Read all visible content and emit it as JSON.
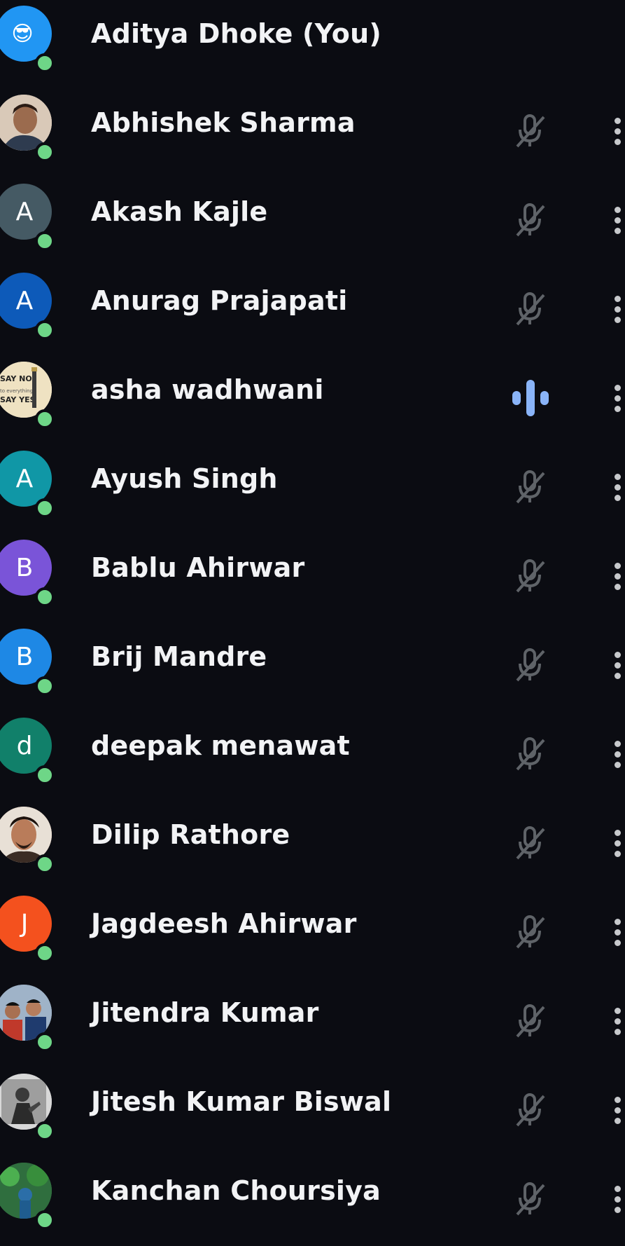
{
  "participants": [
    {
      "name": "Aditya Dhoke (You)",
      "avatar": {
        "type": "emoji",
        "glyph": "😎",
        "bg": "#2196f3"
      },
      "online": true,
      "mic": "none"
    },
    {
      "name": "Abhishek Sharma",
      "avatar": {
        "type": "photo",
        "bg": "#d9c9b8"
      },
      "online": true,
      "mic": "muted"
    },
    {
      "name": "Akash Kajle",
      "avatar": {
        "type": "initial",
        "letter": "A",
        "bg": "#455a64"
      },
      "online": true,
      "mic": "muted"
    },
    {
      "name": "Anurag Prajapati",
      "avatar": {
        "type": "initial",
        "letter": "A",
        "bg": "#0d5ab9"
      },
      "online": true,
      "mic": "muted"
    },
    {
      "name": "asha wadhwani",
      "avatar": {
        "type": "photo",
        "bg": "#efe2c2"
      },
      "online": true,
      "mic": "speaking"
    },
    {
      "name": "Ayush Singh",
      "avatar": {
        "type": "initial",
        "letter": "A",
        "bg": "#1097a6"
      },
      "online": true,
      "mic": "muted"
    },
    {
      "name": "Bablu Ahirwar",
      "avatar": {
        "type": "initial",
        "letter": "B",
        "bg": "#7a54d8"
      },
      "online": true,
      "mic": "muted"
    },
    {
      "name": "Brij Mandre",
      "avatar": {
        "type": "initial",
        "letter": "B",
        "bg": "#1e88e5"
      },
      "online": true,
      "mic": "muted"
    },
    {
      "name": "deepak menawat",
      "avatar": {
        "type": "initial",
        "letter": "d",
        "bg": "#11806a"
      },
      "online": true,
      "mic": "muted"
    },
    {
      "name": "Dilip Rathore",
      "avatar": {
        "type": "photo",
        "bg": "#c89270"
      },
      "online": true,
      "mic": "muted"
    },
    {
      "name": "Jagdeesh Ahirwar",
      "avatar": {
        "type": "initial",
        "letter": "J",
        "bg": "#f4511e"
      },
      "online": true,
      "mic": "muted"
    },
    {
      "name": "Jitendra Kumar",
      "avatar": {
        "type": "photo",
        "bg": "#7a8fa6"
      },
      "online": true,
      "mic": "muted"
    },
    {
      "name": "Jitesh Kumar Biswal",
      "avatar": {
        "type": "photo",
        "bg": "#9a9a9a"
      },
      "online": true,
      "mic": "muted"
    },
    {
      "name": "Kanchan Choursiya",
      "avatar": {
        "type": "photo",
        "bg": "#3d7a4a"
      },
      "online": true,
      "mic": "muted"
    }
  ],
  "icons": {
    "muted": "mic-off-icon",
    "speaking": "audio-level-icon",
    "more": "more-vert-icon",
    "presence": "online-dot"
  },
  "colors": {
    "background": "#0b0c12",
    "online": "#6ed687",
    "speaking": "#8ab4f8",
    "muted_icon": "#5f6368"
  }
}
